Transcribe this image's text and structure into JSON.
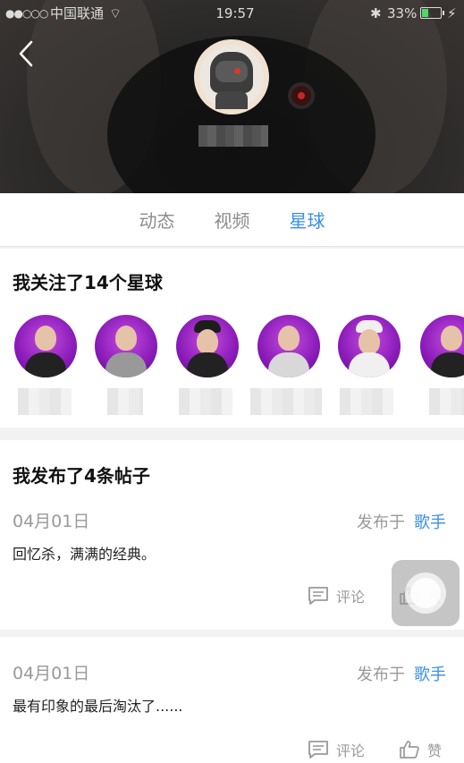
{
  "status_bar": {
    "signal": "●●○○○",
    "carrier": "中国联通",
    "wifi": "⌔",
    "time": "19:57",
    "bluetooth": "✱",
    "battery_percent": "33%",
    "battery_level": 0.33,
    "charging": "⚡"
  },
  "header": {
    "back_icon": "chevron-left-icon",
    "avatar_icon": "robot-avatar"
  },
  "tabs": [
    {
      "label": "动态",
      "active": false
    },
    {
      "label": "视频",
      "active": false
    },
    {
      "label": "星球",
      "active": true
    }
  ],
  "planets": {
    "title": "我关注了14个星球"
  },
  "posts": {
    "title": "我发布了4条帖子",
    "items": [
      {
        "date": "04月01日",
        "published_in_label": "发布于",
        "tag": "歌手",
        "text": "回忆杀，满满的经典。",
        "comment_label": "评论",
        "like_label": "赞"
      },
      {
        "date": "04月01日",
        "published_in_label": "发布于",
        "tag": "歌手",
        "text": "最有印象的最后淘汰了......",
        "comment_label": "评论",
        "like_label": "赞"
      }
    ]
  },
  "colors": {
    "accent": "#3a8ee6",
    "muted": "#999999",
    "planet_purple": "#8a1bb8"
  }
}
